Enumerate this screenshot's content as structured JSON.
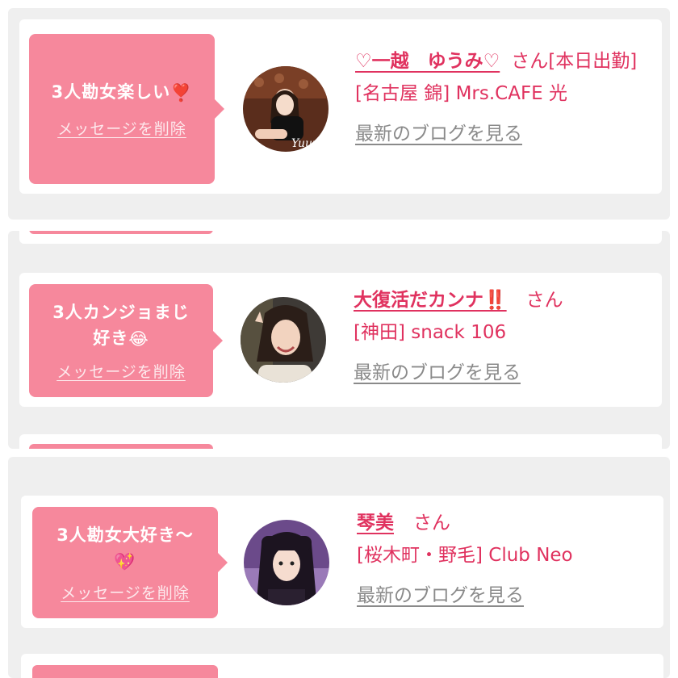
{
  "messages": [
    {
      "message_text": "3人勘女楽しい",
      "message_emoji": "❣️",
      "delete_label": "メッセージを削除",
      "cast_name": "♡一越　ゆうみ♡",
      "honorific": "さん",
      "status": "[本日出勤]",
      "shop": "[名古屋 錦] Mrs.CAFE 光",
      "blog_link": "最新のブログを見る"
    },
    {
      "message_text": "3人カンジョまじ好き",
      "message_emoji": "😂",
      "delete_label": "メッセージを削除",
      "cast_name": "大復活だカンナ",
      "cast_name_emoji": "‼️",
      "honorific": "さん",
      "shop": "[神田] snack 106",
      "blog_link": "最新のブログを見る"
    },
    {
      "message_text": "3人勘女大好き〜",
      "message_emoji": "💖",
      "delete_label": "メッセージを削除",
      "cast_name": "琴美",
      "honorific": "さん",
      "shop": "[桜木町・野毛] Club Neo",
      "blog_link": "最新のブログを見る"
    }
  ],
  "colors": {
    "accent_pink": "#f6889c",
    "name_red": "#e0325f",
    "link_grey": "#8a8a8a",
    "panel_bg": "#efefef"
  }
}
